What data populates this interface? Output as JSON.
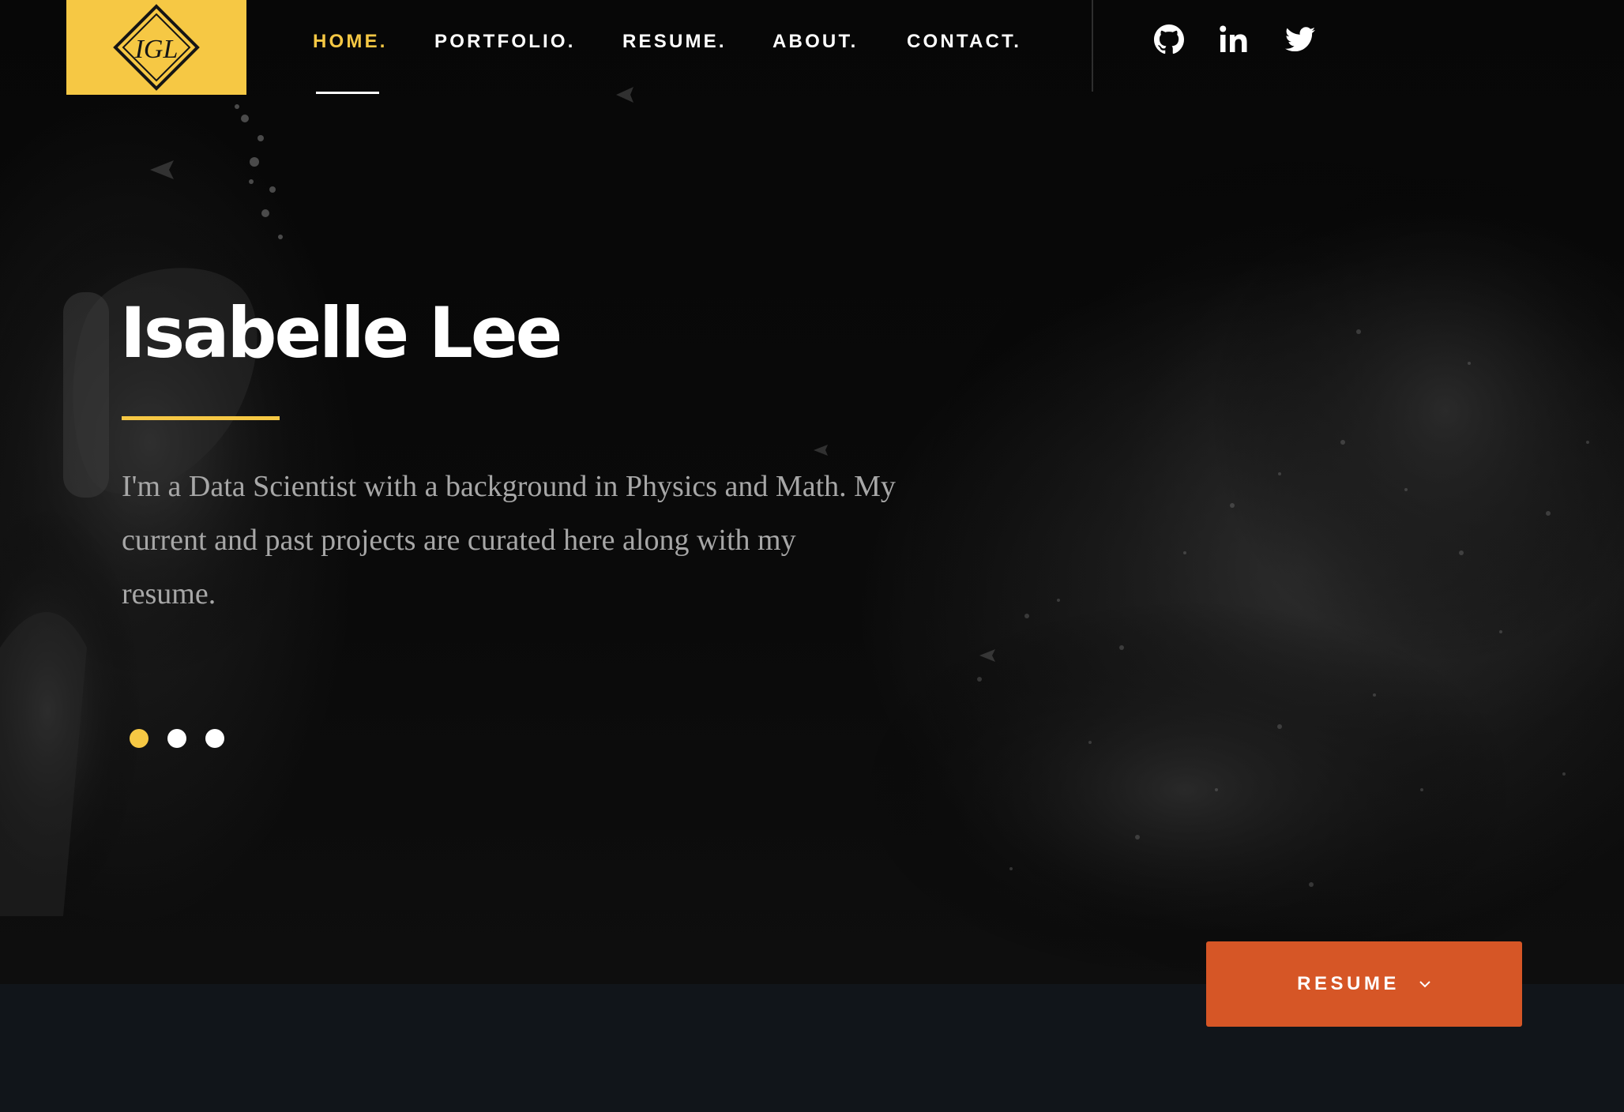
{
  "colors": {
    "accent": "#f6c844",
    "button": "#d65626",
    "background": "#11151a"
  },
  "brand": {
    "logo_text": "IGL"
  },
  "nav": {
    "items": [
      {
        "label": "HOME.",
        "active": true
      },
      {
        "label": "PORTFOLIO.",
        "active": false
      },
      {
        "label": "RESUME.",
        "active": false
      },
      {
        "label": "ABOUT.",
        "active": false
      },
      {
        "label": "CONTACT.",
        "active": false
      }
    ],
    "social": [
      {
        "icon": "github-icon"
      },
      {
        "icon": "linkedin-icon"
      },
      {
        "icon": "twitter-icon"
      }
    ]
  },
  "hero": {
    "title": "Isabelle Lee",
    "subtitle": "I'm a Data Scientist with a background in Physics and Math. My current and past projects are curated here along with my resume.",
    "slides": {
      "count": 3,
      "active": 1
    }
  },
  "cta": {
    "label": "RESUME"
  }
}
